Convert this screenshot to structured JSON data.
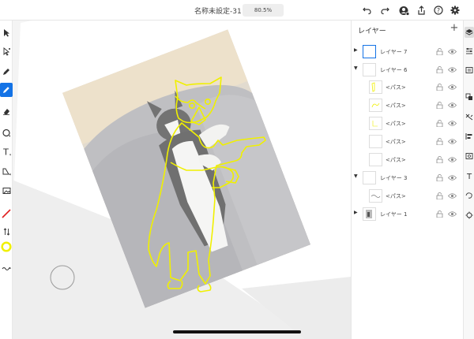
{
  "document": {
    "title": "名称未設定-31",
    "zoom": "80.5%"
  },
  "layers_panel": {
    "title": "レイヤー",
    "add_label": "+",
    "rows": [
      {
        "name": "レイヤー 7",
        "kind": "layer",
        "expanded": false,
        "selected": true
      },
      {
        "name": "レイヤー 6",
        "kind": "layer",
        "expanded": true,
        "selected": false
      },
      {
        "name": "<パス>",
        "kind": "path",
        "selected": false
      },
      {
        "name": "<パス>",
        "kind": "path",
        "selected": false
      },
      {
        "name": "<パス>",
        "kind": "path",
        "selected": false
      },
      {
        "name": "<パス>",
        "kind": "path",
        "selected": false
      },
      {
        "name": "<パス>",
        "kind": "path",
        "selected": false
      },
      {
        "name": "レイヤー 3",
        "kind": "layer",
        "expanded": true,
        "selected": false
      },
      {
        "name": "<パス>",
        "kind": "path",
        "selected": false
      },
      {
        "name": "レイヤー 1",
        "kind": "layer",
        "expanded": false,
        "selected": false
      }
    ]
  },
  "colors": {
    "accent": "#1473e6",
    "stroke_color": "#f0f000",
    "fill_none_indicator": "#e02020"
  },
  "icons": {
    "top": [
      "undo-icon",
      "redo-icon",
      "account-icon",
      "share-icon",
      "help-icon",
      "settings-icon"
    ],
    "left_tools": [
      "selection-icon",
      "direct-selection-icon",
      "pen-icon",
      "pencil-icon",
      "eraser-icon",
      "ellipse-icon",
      "type-icon",
      "shape-icon",
      "image-icon",
      "fill-none-icon",
      "swap-icon",
      "stroke-color-icon",
      "more-tools-icon"
    ],
    "right_tools": [
      "layers-icon",
      "properties-icon",
      "libraries-icon",
      "artboards-icon",
      "transform-icon",
      "align-icon",
      "image-trace-icon",
      "type-properties-icon",
      "shapes-icon",
      "plugins-icon"
    ]
  }
}
